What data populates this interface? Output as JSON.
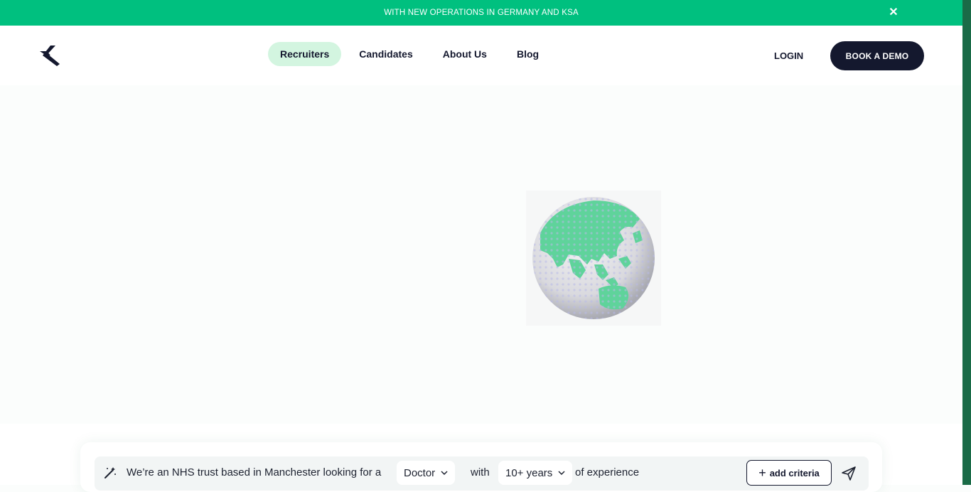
{
  "announcement": {
    "text": "WITH NEW OPERATIONS IN GERMANY AND KSA",
    "close_icon": "close-icon"
  },
  "header": {
    "logo_icon": "brand-logo-icon",
    "nav": [
      {
        "label": "Recruiters",
        "active": true
      },
      {
        "label": "Candidates",
        "active": false
      },
      {
        "label": "About Us",
        "active": false
      },
      {
        "label": "Blog",
        "active": false
      }
    ],
    "login_label": "LOGIN",
    "demo_label": "BOOK A DEMO"
  },
  "hero": {
    "globe_icon": "globe-icon"
  },
  "search": {
    "wand_icon": "magic-wand-icon",
    "prefix": "We’re an NHS trust based in Manchester looking for a",
    "role_value": "Doctor",
    "middle": "with",
    "experience_value": "10+ years",
    "suffix": "of experience",
    "add_label": "add criteria",
    "send_icon": "send-icon"
  },
  "colors": {
    "brand_green": "#00c07f",
    "dark_navy": "#14182e",
    "active_nav_bg": "#d3f5e0",
    "globe_green": "#5fd39b"
  }
}
